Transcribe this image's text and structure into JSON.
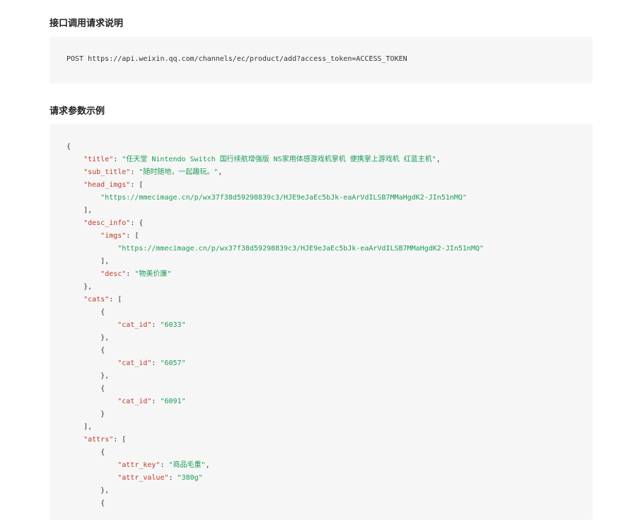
{
  "doc": {
    "section1_title": "接口调用请求说明",
    "request_line": "POST https://api.weixin.qq.com/channels/ec/product/add?access_token=ACCESS_TOKEN",
    "section2_title": "请求参数示例"
  },
  "code": {
    "lines": [
      [
        {
          "t": "p",
          "v": "{"
        }
      ],
      [
        {
          "t": "p",
          "v": "    "
        },
        {
          "t": "k",
          "v": "\"title\""
        },
        {
          "t": "p",
          "v": ": "
        },
        {
          "t": "s",
          "v": "\"任天堂 Nintendo Switch 国行续航增强版 NS家用体感游戏机掌机 便携掌上游戏机 红蓝主机\""
        },
        {
          "t": "p",
          "v": ","
        }
      ],
      [
        {
          "t": "p",
          "v": "    "
        },
        {
          "t": "k",
          "v": "\"sub_title\""
        },
        {
          "t": "p",
          "v": ": "
        },
        {
          "t": "s",
          "v": "\"随时随地，一起趣玩。\""
        },
        {
          "t": "p",
          "v": ","
        }
      ],
      [
        {
          "t": "p",
          "v": "    "
        },
        {
          "t": "k",
          "v": "\"head_imgs\""
        },
        {
          "t": "p",
          "v": ": ["
        }
      ],
      [
        {
          "t": "p",
          "v": "        "
        },
        {
          "t": "s",
          "v": "\"https://mmecimage.cn/p/wx37f38d59298839c3/HJE9eJaEc5bJk-eaArVdILSB7MMaHgdK2-JIn51nMQ\""
        }
      ],
      [
        {
          "t": "p",
          "v": "    ],"
        }
      ],
      [
        {
          "t": "p",
          "v": "    "
        },
        {
          "t": "k",
          "v": "\"desc_info\""
        },
        {
          "t": "p",
          "v": ": {"
        }
      ],
      [
        {
          "t": "p",
          "v": "        "
        },
        {
          "t": "k",
          "v": "\"imgs\""
        },
        {
          "t": "p",
          "v": ": ["
        }
      ],
      [
        {
          "t": "p",
          "v": "            "
        },
        {
          "t": "s",
          "v": "\"https://mmecimage.cn/p/wx37f38d59298839c3/HJE9eJaEc5bJk-eaArVdILSB7MMaHgdK2-JIn51nMQ\""
        }
      ],
      [
        {
          "t": "p",
          "v": "        ],"
        }
      ],
      [
        {
          "t": "p",
          "v": "        "
        },
        {
          "t": "k",
          "v": "\"desc\""
        },
        {
          "t": "p",
          "v": ": "
        },
        {
          "t": "s",
          "v": "\"物美价廉\""
        }
      ],
      [
        {
          "t": "p",
          "v": "    },"
        }
      ],
      [
        {
          "t": "p",
          "v": "    "
        },
        {
          "t": "k",
          "v": "\"cats\""
        },
        {
          "t": "p",
          "v": ": ["
        }
      ],
      [
        {
          "t": "p",
          "v": "        {"
        }
      ],
      [
        {
          "t": "p",
          "v": "            "
        },
        {
          "t": "k",
          "v": "\"cat_id\""
        },
        {
          "t": "p",
          "v": ": "
        },
        {
          "t": "s",
          "v": "\"6033\""
        }
      ],
      [
        {
          "t": "p",
          "v": "        },"
        }
      ],
      [
        {
          "t": "p",
          "v": "        {"
        }
      ],
      [
        {
          "t": "p",
          "v": "            "
        },
        {
          "t": "k",
          "v": "\"cat_id\""
        },
        {
          "t": "p",
          "v": ": "
        },
        {
          "t": "s",
          "v": "\"6057\""
        }
      ],
      [
        {
          "t": "p",
          "v": "        },"
        }
      ],
      [
        {
          "t": "p",
          "v": "        {"
        }
      ],
      [
        {
          "t": "p",
          "v": "            "
        },
        {
          "t": "k",
          "v": "\"cat_id\""
        },
        {
          "t": "p",
          "v": ": "
        },
        {
          "t": "s",
          "v": "\"6091\""
        }
      ],
      [
        {
          "t": "p",
          "v": "        }"
        }
      ],
      [
        {
          "t": "p",
          "v": "    ],"
        }
      ],
      [
        {
          "t": "p",
          "v": "    "
        },
        {
          "t": "k",
          "v": "\"attrs\""
        },
        {
          "t": "p",
          "v": ": ["
        }
      ],
      [
        {
          "t": "p",
          "v": "        {"
        }
      ],
      [
        {
          "t": "p",
          "v": "            "
        },
        {
          "t": "k",
          "v": "\"attr_key\""
        },
        {
          "t": "p",
          "v": ": "
        },
        {
          "t": "s",
          "v": "\"商品毛重\""
        },
        {
          "t": "p",
          "v": ","
        }
      ],
      [
        {
          "t": "p",
          "v": "            "
        },
        {
          "t": "k",
          "v": "\"attr_value\""
        },
        {
          "t": "p",
          "v": ": "
        },
        {
          "t": "s",
          "v": "\"380g\""
        }
      ],
      [
        {
          "t": "p",
          "v": "        },"
        }
      ],
      [
        {
          "t": "p",
          "v": "        {"
        }
      ]
    ]
  },
  "colors": {
    "key": "#c0392b",
    "string": "#1a9c55",
    "punct": "#333333",
    "code_bg": "#f6f6f6"
  }
}
